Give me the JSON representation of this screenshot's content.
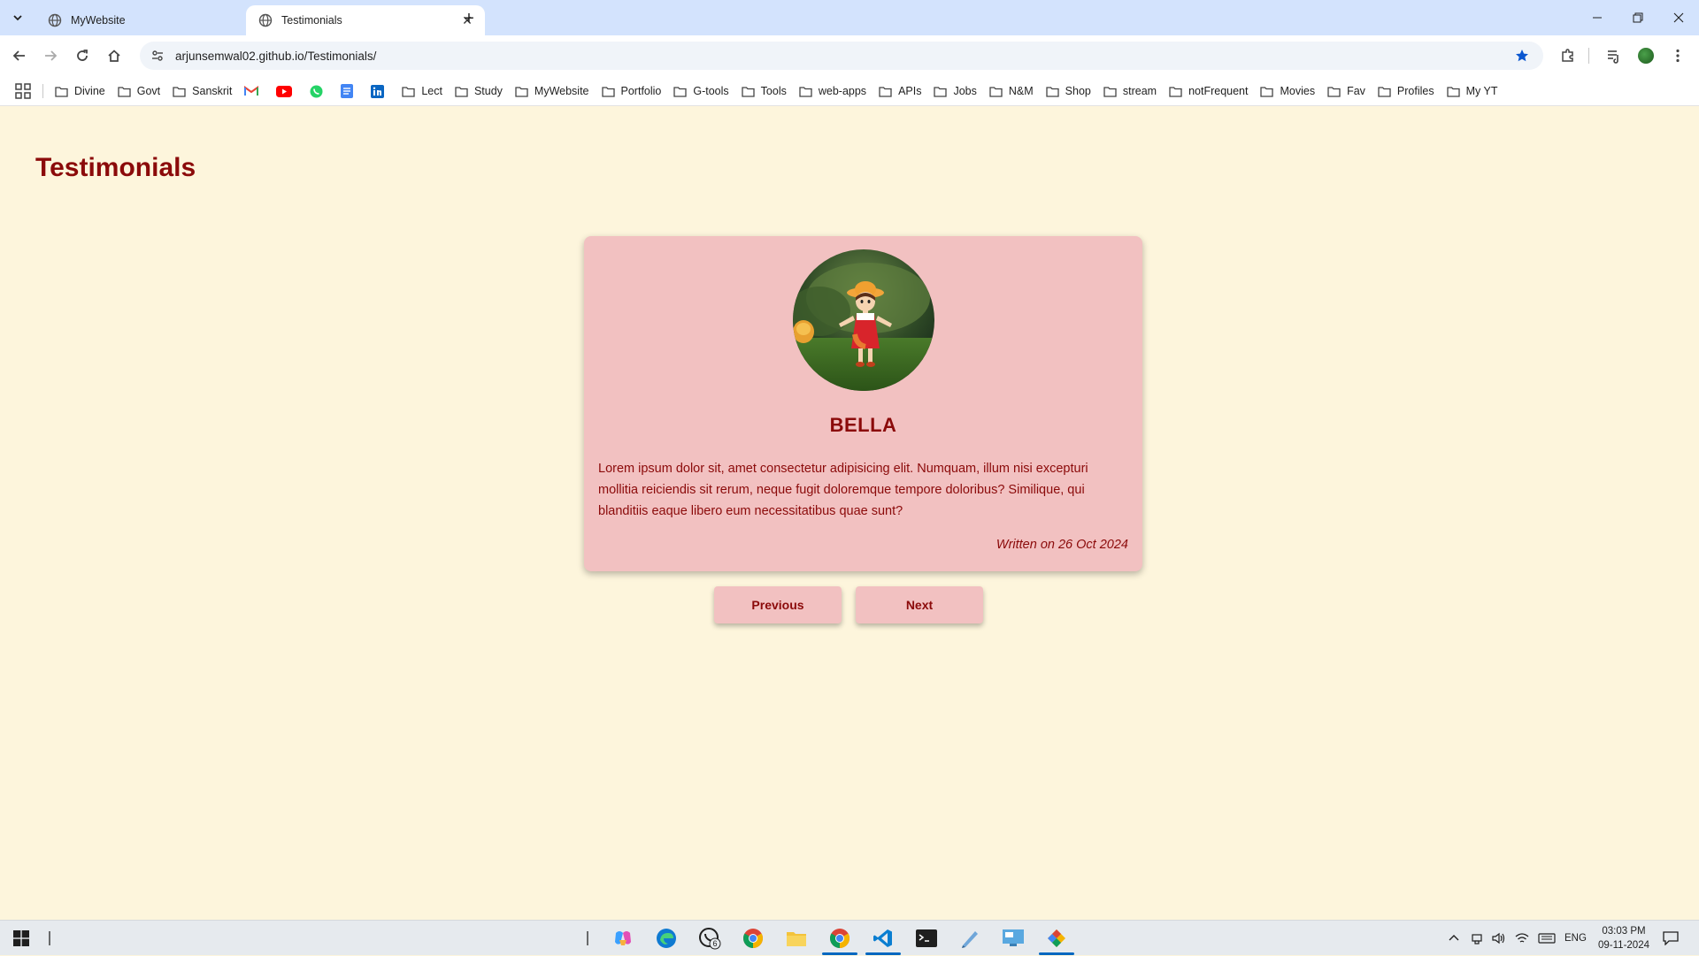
{
  "browser": {
    "tabs": [
      {
        "title": "MyWebsite",
        "active": false
      },
      {
        "title": "Testimonials",
        "active": true
      }
    ],
    "url": "arjunsemwal02.github.io/Testimonials/",
    "bookmarks": [
      "Divine",
      "Govt",
      "Sanskrit",
      "Lect",
      "Study",
      "MyWebsite",
      "Portfolio",
      "G-tools",
      "Tools",
      "web-apps",
      "APIs",
      "Jobs",
      "N&M",
      "Shop",
      "stream",
      "notFrequent",
      "Movies",
      "Fav",
      "Profiles",
      "My YT"
    ],
    "bookmark_icons": [
      "gmail-icon",
      "youtube-icon",
      "whatsapp-icon",
      "docs-icon",
      "linkedin-icon"
    ]
  },
  "page": {
    "title": "Testimonials",
    "testimonial": {
      "name": "BELLA",
      "text": "Lorem ipsum dolor sit, amet consectetur adipisicing elit. Numquam, illum nisi excepturi mollitia reiciendis sit rerum, neque fugit doloremque tempore doloribus? Similique, qui blanditiis eaque libero eum necessitatibus quae sunt?",
      "written_on": "Written on 26 Oct 2024"
    },
    "buttons": {
      "previous": "Previous",
      "next": "Next"
    }
  },
  "taskbar": {
    "whatsapp_badge": "6",
    "language": "ENG",
    "time": "03:03 PM",
    "date": "09-11-2024"
  },
  "colors": {
    "page_bg": "#fdf5dc",
    "card_bg": "#f2c1c1",
    "accent_text": "#8b0a0a",
    "chrome_tabbar": "#d3e3fd"
  }
}
